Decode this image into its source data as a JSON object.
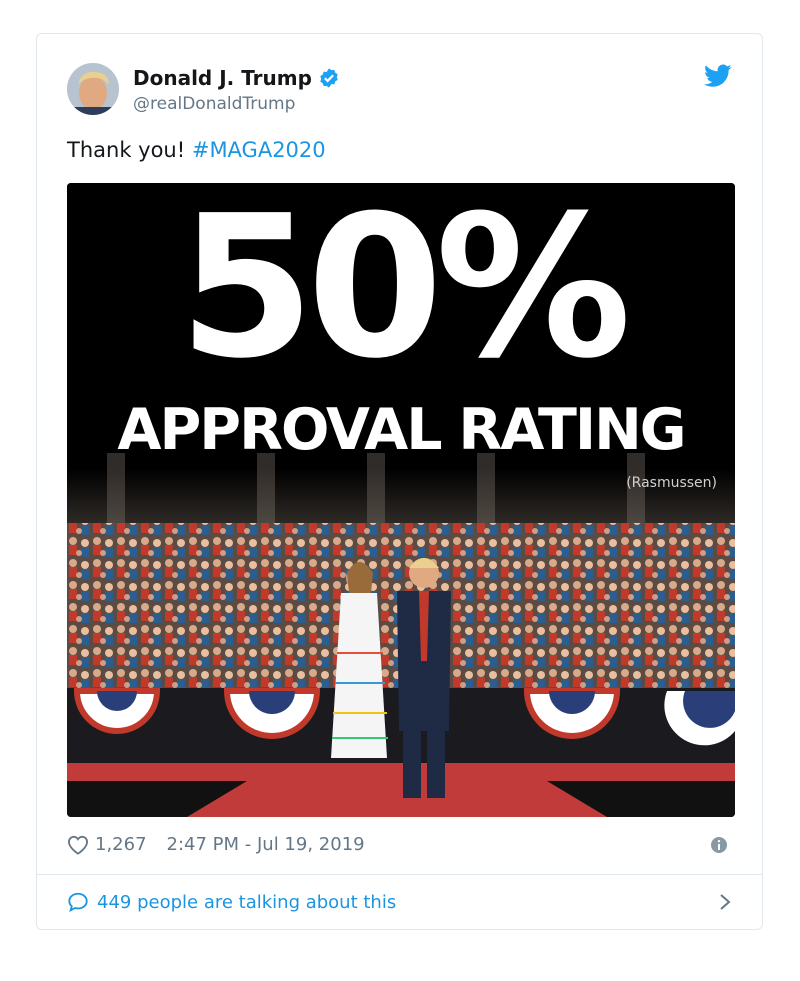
{
  "author": {
    "name": "Donald J. Trump",
    "handle": "@realDonaldTrump"
  },
  "tweet": {
    "text": "Thank you! ",
    "hashtag": "#MAGA2020"
  },
  "media": {
    "headline": "50%",
    "subheadline": "APPROVAL RATING",
    "source": "(Rasmussen)"
  },
  "meta": {
    "likes": "1,267",
    "timestamp": "2:47 PM - Jul 19, 2019"
  },
  "conversation": {
    "label": "449 people are talking about this"
  },
  "icons": {
    "brand": "twitter-bird-icon",
    "verified": "verified-badge-icon",
    "like": "heart-icon",
    "info": "info-icon",
    "reply": "speech-bubble-icon",
    "chevron": "chevron-right-icon"
  },
  "colors": {
    "accent": "#1b95e0",
    "muted": "#657786",
    "text": "#14171a",
    "border": "#e1e8ed"
  }
}
